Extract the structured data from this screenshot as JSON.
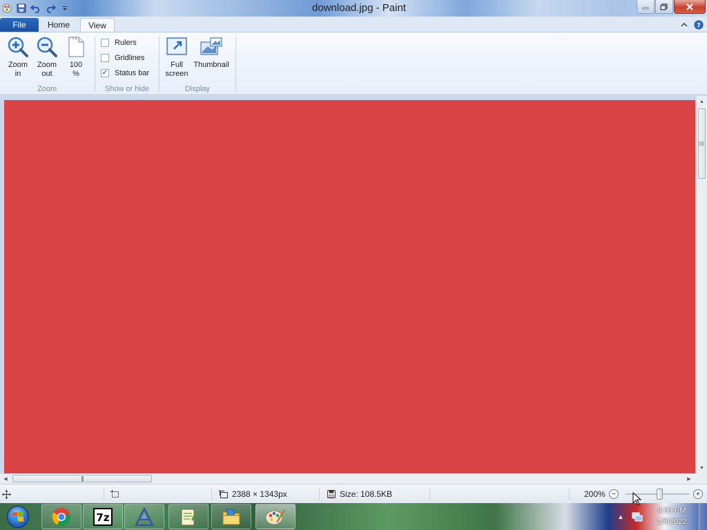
{
  "window": {
    "title": "download.jpg - Paint"
  },
  "quick_access": {
    "icons": [
      "paint-app-icon",
      "save-icon",
      "undo-icon",
      "redo-icon",
      "customize-dropdown-icon"
    ]
  },
  "tabs": {
    "file": "File",
    "home": "Home",
    "view": "View",
    "active": "View"
  },
  "ribbon": {
    "zoom_group": {
      "label": "Zoom",
      "zoom_in_l1": "Zoom",
      "zoom_in_l2": "in",
      "zoom_out_l1": "Zoom",
      "zoom_out_l2": "out",
      "hundred_l1": "100",
      "hundred_l2": "%"
    },
    "show_hide_group": {
      "label": "Show or hide",
      "rulers": "Rulers",
      "rulers_checked": false,
      "gridlines": "Gridlines",
      "gridlines_checked": false,
      "status_bar": "Status bar",
      "status_bar_checked": true,
      "check_glyph": "✓"
    },
    "display_group": {
      "label": "Display",
      "full_screen_l1": "Full",
      "full_screen_l2": "screen",
      "thumbnail": "Thumbnail"
    }
  },
  "canvas": {
    "fill_color": "#db4444"
  },
  "statusbar": {
    "dimensions": "2388 × 1343px",
    "size": "Size: 108.5KB",
    "zoom": "200%",
    "zoom_minus": "−",
    "zoom_plus": "+"
  },
  "scrollbars": {
    "grip": "|||"
  },
  "taskbar": {
    "apps": [
      "chrome-icon",
      "7zip-icon",
      "app-icon",
      "notepadpp-icon",
      "file-explorer-icon",
      "paint-icon"
    ],
    "active_app": "paint-icon",
    "tray_arrow": "▲",
    "time": "4:50 PM",
    "date": "1/5/2022"
  },
  "colors": {
    "accent_file_tab": "#1a4f9c",
    "canvas_red": "#db4444",
    "workspace_bg": "#c9d8ec"
  }
}
